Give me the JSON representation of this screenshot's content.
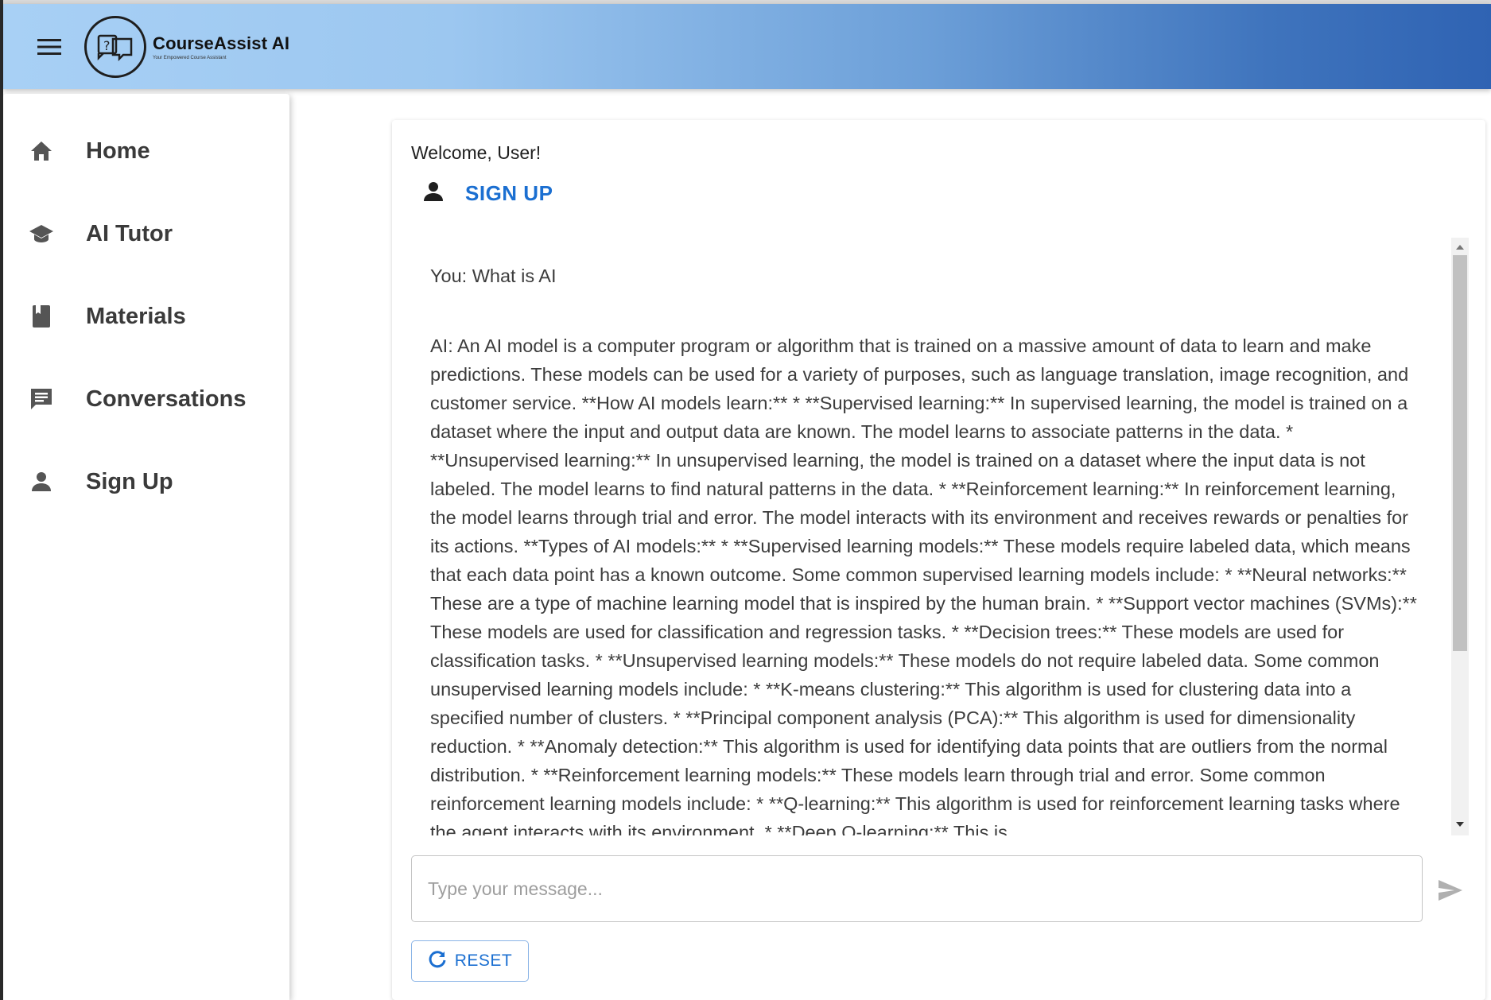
{
  "header": {
    "brand_name": "CourseAssist AI",
    "brand_tagline": "Your Empowered Course Assistant",
    "menu_icon": "hamburger-menu-icon",
    "logo_icon": "chat-question-logo-icon",
    "gradient_colors": [
      "#a8d0f5",
      "#2f63b3"
    ]
  },
  "sidebar": {
    "items": [
      {
        "label": "Home",
        "icon": "home-icon"
      },
      {
        "label": "AI Tutor",
        "icon": "graduation-cap-icon"
      },
      {
        "label": "Materials",
        "icon": "book-icon"
      },
      {
        "label": "Conversations",
        "icon": "chat-icon"
      },
      {
        "label": "Sign Up",
        "icon": "person-icon"
      }
    ]
  },
  "main": {
    "welcome_text": "Welcome, User!",
    "signup_label": "SIGN UP",
    "accent_color": "#1b6fd1",
    "messages": [
      {
        "role": "user",
        "text": "You: What is AI"
      },
      {
        "role": "ai",
        "text": "AI: An AI model is a computer program or algorithm that is trained on a massive amount of data to learn and make predictions. These models can be used for a variety of purposes, such as language translation, image recognition, and customer service. **How AI models learn:** * **Supervised learning:** In supervised learning, the model is trained on a dataset where the input and output data are known. The model learns to associate patterns in the data. * **Unsupervised learning:** In unsupervised learning, the model is trained on a dataset where the input data is not labeled. The model learns to find natural patterns in the data. * **Reinforcement learning:** In reinforcement learning, the model learns through trial and error. The model interacts with its environment and receives rewards or penalties for its actions. **Types of AI models:** * **Supervised learning models:** These models require labeled data, which means that each data point has a known outcome. Some common supervised learning models include: * **Neural networks:** These are a type of machine learning model that is inspired by the human brain. * **Support vector machines (SVMs):** These models are used for classification and regression tasks. * **Decision trees:** These models are used for classification tasks. * **Unsupervised learning models:** These models do not require labeled data. Some common unsupervised learning models include: * **K-means clustering:** This algorithm is used for clustering data into a specified number of clusters. * **Principal component analysis (PCA):** This algorithm is used for dimensionality reduction. * **Anomaly detection:** This algorithm is used for identifying data points that are outliers from the normal distribution. * **Reinforcement learning models:** These models learn through trial and error. Some common reinforcement learning models include: * **Q-learning:** This algorithm is used for reinforcement learning tasks where the agent interacts with its environment. * **Deep Q-learning:** This is"
      }
    ],
    "input_placeholder": "Type your message...",
    "input_value": "",
    "send_icon": "send-icon",
    "reset_label": "RESET",
    "reset_icon": "refresh-icon"
  }
}
